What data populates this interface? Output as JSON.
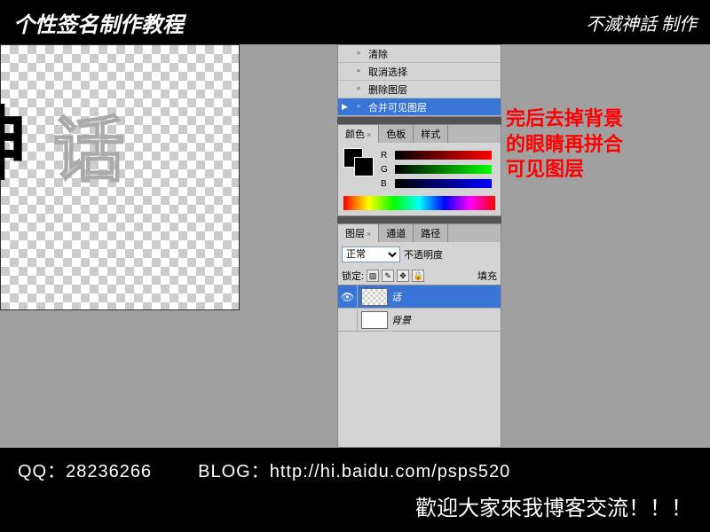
{
  "header": {
    "title": "个性签名制作教程",
    "logo": "不滅神話 制作"
  },
  "canvas": {
    "char1": "神",
    "char2": "话"
  },
  "history": {
    "items": [
      {
        "label": "清除",
        "selected": false
      },
      {
        "label": "取消选择",
        "selected": false
      },
      {
        "label": "删除图层",
        "selected": false
      },
      {
        "label": "合并可见图层",
        "selected": true
      }
    ]
  },
  "color_panel": {
    "tabs": [
      "颜色",
      "色板",
      "样式"
    ],
    "active_tab": 0,
    "channels": [
      {
        "label": "R"
      },
      {
        "label": "G"
      },
      {
        "label": "B"
      }
    ]
  },
  "layers_panel": {
    "tabs": [
      "图层",
      "通道",
      "路径"
    ],
    "active_tab": 0,
    "blend_mode": "正常",
    "opacity_label": "不透明度",
    "lock_label": "锁定:",
    "fill_label": "填充",
    "layers": [
      {
        "name": "话",
        "visible": true,
        "selected": true,
        "checker": true
      },
      {
        "name": "背景",
        "visible": false,
        "selected": false,
        "checker": false
      }
    ]
  },
  "annotation": {
    "line1": "完后去掉背景",
    "line2": "的眼睛再拼合",
    "line3": "可见图层"
  },
  "footer": {
    "qq_label": "QQ：",
    "qq": "28236266",
    "blog_label": "BLOG：",
    "blog": "http://hi.baidu.com/psps520",
    "welcome": "歡迎大家來我博客交流！！！"
  }
}
